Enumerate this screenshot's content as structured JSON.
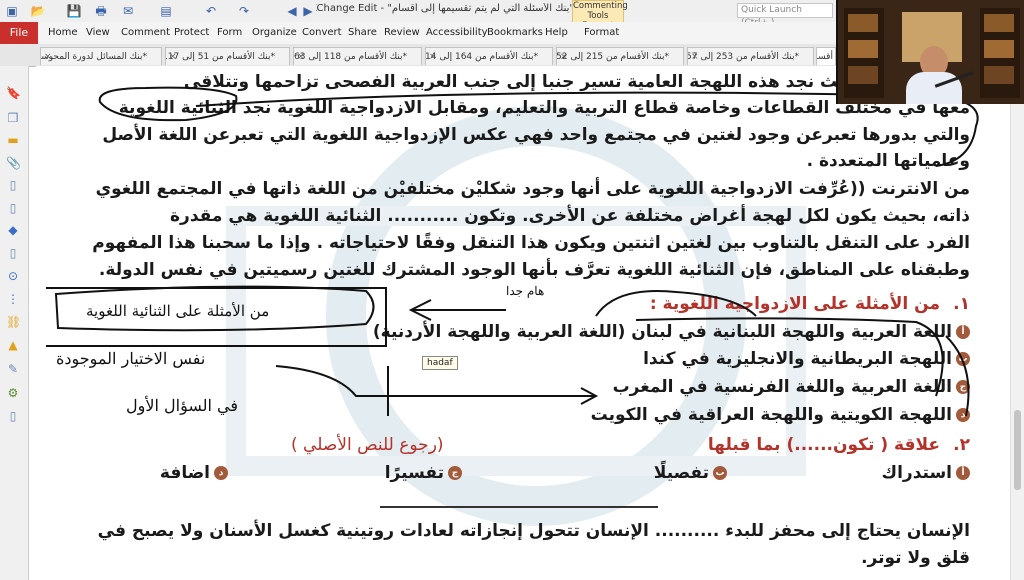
{
  "app": {
    "doc_title": "\"بنك الأسئلة التي لم يتم تقسيمها إلى أقسام\" - PDF-XChange Edit...",
    "context_tab": "Commenting Tools",
    "context_subtab": "Format",
    "quick_launch_placeholder": "Quick Launch (Ctrl+.)",
    "file_label": "File"
  },
  "menu": [
    "Home",
    "View",
    "Comment",
    "Protect",
    "Form",
    "Organize",
    "Convert",
    "Share",
    "Review",
    "Accessibility",
    "Bookmarks",
    "Help",
    "Format"
  ],
  "tabs": [
    {
      "label": "*بنك المسائل لدورة المحوسب"
    },
    {
      "label": "*بنك الأقسام من 51 إلى 117"
    },
    {
      "label": "*بنك الأقسام من 118 إلى 163"
    },
    {
      "label": "*بنك الأقسام من 164 إلى 214"
    },
    {
      "label": "*بنك الأقسام من 215 إلى 252"
    },
    {
      "label": "*بنك الأقسام من 253 إلى 257"
    },
    {
      "label": "أقسام"
    }
  ],
  "sidebar_icons": [
    "bookmark-icon",
    "pages-icon",
    "comments-icon",
    "attachments-icon",
    "document-icon",
    "document-icon",
    "layers-icon",
    "document-icon",
    "location-icon",
    "structure-icon",
    "link-icon",
    "stamp-icon",
    "signature-icon",
    "tools-icon",
    "document-icon"
  ],
  "page": {
    "lines": [
      "بشكل عامي، حيث نجد هذه اللهجة العامية تسير جنبا إلى جنب العربية الفصحى تزاحمها وتتلاقى",
      "معها في مختلف القطاعات وخاصة قطاع التربية والتعليم، ومقابل الازدواجية اللغوية نجد الثنائية اللغوية",
      "والتي بدورها تعبرعن وجود لغتين في مجتمع واحد فهي عكس الإزدواجية اللغوية التي تعبرعن اللغة الأصل",
      "وعامياتها المتعددة .",
      "من الانترنت ((عُرِّفت الازدواجية اللغوية على أنها وجود شكليْن مختلفيْن من اللغة ذاتها في المجتمع اللغوي",
      "ذاته، بحيث يكون لكل لهجة أغراض مختلفة عن الأخرى. وتكون ........... الثنائية اللغوية هي مقدرة",
      "الفرد على التنقل بالتناوب بين لغتين اثنتين ويكون هذا التنقل وفقًا لاحتياجاته . وإذا ما سحبنا هذا المفهوم",
      "وطبقناه على المناطق، فإن الثنائية اللغوية تعرَّف بأنها الوجود المشترك للغتين رسميتين في نفس الدولة."
    ],
    "q1": {
      "number": "١.",
      "text": "من الأمثلة على الازدواجية اللغوية :",
      "options": [
        {
          "letter": "أ",
          "text": "اللغة العربية واللهجة اللبنانية في لبنان (اللغة العربية واللهجة الأردنية)"
        },
        {
          "letter": "ب",
          "text": "اللهجة البريطانية والانجليزية في كندا"
        },
        {
          "letter": "ج",
          "text": "اللغة العربية واللغة الفرنسية في المغرب"
        },
        {
          "letter": "د",
          "text": "اللهجة الكويتية واللهجة العراقية في الكويت"
        }
      ]
    },
    "q2": {
      "number": "٢.",
      "text": "علاقة ( تكون......) بما قبلها",
      "hint": "(رجوع للنص الأصلي )",
      "options": [
        {
          "letter": "أ",
          "text": "استدراك"
        },
        {
          "letter": "ب",
          "text": "تفصيلًا"
        },
        {
          "letter": "ج",
          "text": "تفسيرًا"
        },
        {
          "letter": "د",
          "text": "اضافة"
        }
      ]
    },
    "para2": [
      "الإنسان يحتاج إلى محفز للبدء .......... الإنسان تتحول إنجازاته لعادات روتينية كغسل الأسنان ولا يصبح في",
      "قلق ولا توتر."
    ],
    "tooltip": "hadaf",
    "handwriting": {
      "box_note": "من الأمثلة على الثنائية اللغوية",
      "side_note_1": "نفس الاختيار الموجودة",
      "side_note_2": "في السؤال الأول",
      "arrow_note": "هام جدا"
    }
  }
}
